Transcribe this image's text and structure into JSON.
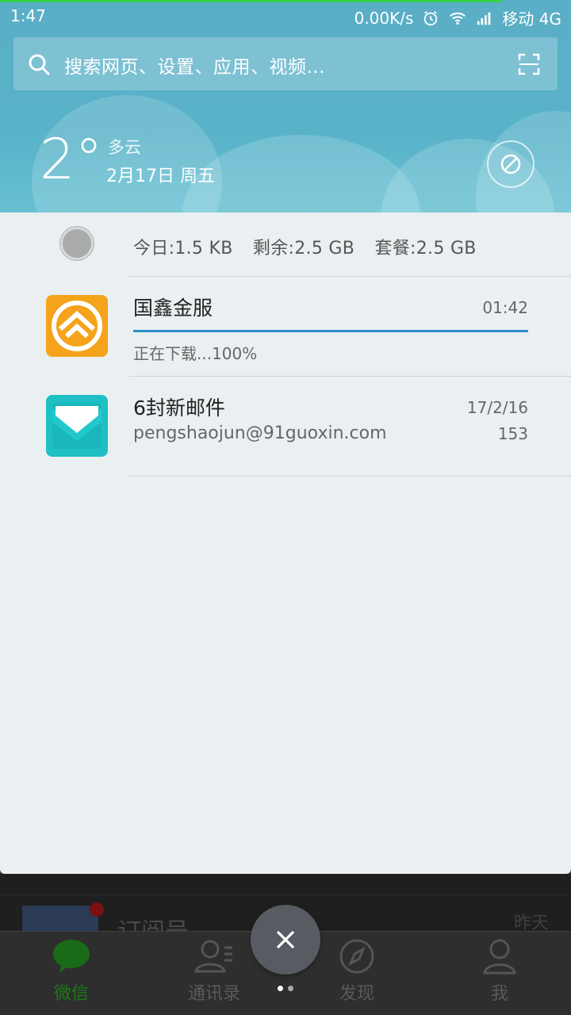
{
  "status_bar": {
    "time": "1:47",
    "speed": "0.00K/s",
    "carrier": "移动 4G"
  },
  "search": {
    "placeholder": "搜索网页、设置、应用、视频..."
  },
  "weather": {
    "temperature": "2°",
    "condition": "多云",
    "date": "2月17日 周五"
  },
  "data_usage": {
    "today": "今日:1.5 KB",
    "remaining": "剩余:2.5 GB",
    "plan": "套餐:2.5 GB"
  },
  "notifications": [
    {
      "app": "国鑫金服",
      "time": "01:42",
      "status": "正在下载...100%",
      "progress": 1.0,
      "icon": "guoxin-app-icon"
    },
    {
      "app": "6封新邮件",
      "time": "17/2/16",
      "sender": "pengshaojun@91guoxin.com",
      "count": "153",
      "icon": "mail-app-icon"
    }
  ],
  "background_app": {
    "list_item_title": "订阅号",
    "list_item_time": "昨天",
    "tabs": [
      {
        "label": "微信",
        "icon": "chat-bubble-icon",
        "active": true
      },
      {
        "label": "通讯录",
        "icon": "contacts-icon",
        "active": false
      },
      {
        "label": "发现",
        "icon": "compass-icon",
        "active": false
      },
      {
        "label": "我",
        "icon": "person-icon",
        "active": false
      }
    ]
  },
  "colors": {
    "header_bg": "#5aaec6",
    "panel_bg": "#eaf0f1",
    "progress_blue": "#2a8fc7",
    "guoxin_orange": "#f5a31a",
    "mail_teal": "#1fc0c4",
    "wechat_green": "#1a7a16"
  }
}
